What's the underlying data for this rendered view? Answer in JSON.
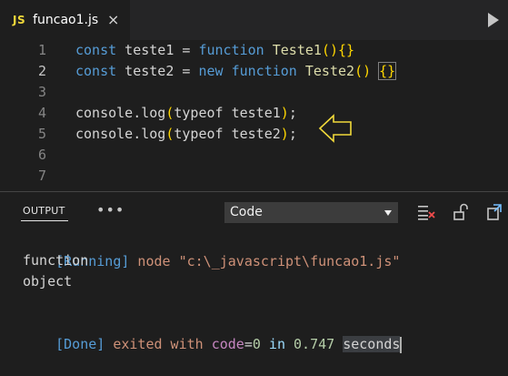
{
  "tab": {
    "lang_badge": "JS",
    "filename": "funcao1.js",
    "close_glyph": "×"
  },
  "editor": {
    "lines": [
      {
        "number": "1",
        "tokens": [
          {
            "t": "const",
            "c": "kw"
          },
          {
            "t": " teste1 = ",
            "c": ""
          },
          {
            "t": "function",
            "c": "kw"
          },
          {
            "t": " ",
            "c": ""
          },
          {
            "t": "Teste1",
            "c": "fn"
          },
          {
            "t": "()",
            "c": "br"
          },
          {
            "t": "{}",
            "c": "br"
          }
        ]
      },
      {
        "number": "2",
        "tokens": [
          {
            "t": "const",
            "c": "kw"
          },
          {
            "t": " teste2 = ",
            "c": ""
          },
          {
            "t": "new",
            "c": "kw"
          },
          {
            "t": " ",
            "c": ""
          },
          {
            "t": "function",
            "c": "kw"
          },
          {
            "t": " ",
            "c": ""
          },
          {
            "t": "Teste2",
            "c": "fn"
          },
          {
            "t": "()",
            "c": "br"
          },
          {
            "t": " ",
            "c": ""
          },
          {
            "t": "{}",
            "c": "br bm"
          }
        ]
      },
      {
        "number": "3",
        "tokens": []
      },
      {
        "number": "4",
        "tokens": [
          {
            "t": "console.log",
            "c": ""
          },
          {
            "t": "(",
            "c": "br"
          },
          {
            "t": "typeof",
            "c": ""
          },
          {
            "t": " teste1",
            "c": ""
          },
          {
            "t": ")",
            "c": "br"
          },
          {
            "t": ";",
            "c": ""
          }
        ]
      },
      {
        "number": "5",
        "tokens": [
          {
            "t": "console.log",
            "c": ""
          },
          {
            "t": "(",
            "c": "br"
          },
          {
            "t": "typeof",
            "c": ""
          },
          {
            "t": " teste2",
            "c": ""
          },
          {
            "t": ")",
            "c": "br"
          },
          {
            "t": ";",
            "c": ""
          }
        ]
      },
      {
        "number": "6",
        "tokens": []
      },
      {
        "number": "7",
        "tokens": []
      }
    ],
    "active_line": "2"
  },
  "panel": {
    "output_tab": "OUTPUT",
    "more_glyph": "•••",
    "channel": "Code",
    "output": {
      "running_tag": "[Running]",
      "running_cmd": " node \"c:\\_javascript\\funcao1.js\"",
      "result1": "function",
      "result2": "object",
      "done_tag": "[Done]",
      "done_text_1": " exited with ",
      "done_code": "code",
      "done_eq": "=",
      "done_code_val": "0",
      "done_in": " in ",
      "done_time": "0.747",
      "done_space": " ",
      "done_unit": "seconds"
    }
  },
  "colors": {
    "arrow": "#f1d93a",
    "background": "#1e1e1e"
  }
}
